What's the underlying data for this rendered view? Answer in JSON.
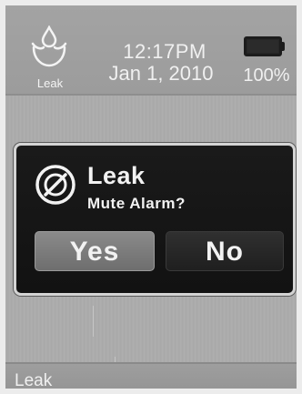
{
  "status_bar": {
    "app_icon": "leak-drop-icon",
    "app_label": "Leak",
    "time": "12:17PM",
    "date": "Jan 1, 2010",
    "battery_icon": "battery-icon",
    "battery_level": 1.0,
    "battery_text": "100%"
  },
  "dialog": {
    "icon": "mute-alarm-icon",
    "title": "Leak",
    "message": "Mute Alarm?",
    "yes_label": "Yes",
    "no_label": "No"
  },
  "bottom_bar": {
    "label": "Leak"
  },
  "colors": {
    "dialog_background": "#121212",
    "yes_button": "#7c7c7c",
    "no_button": "#262626",
    "text": "#f2f2f2"
  }
}
